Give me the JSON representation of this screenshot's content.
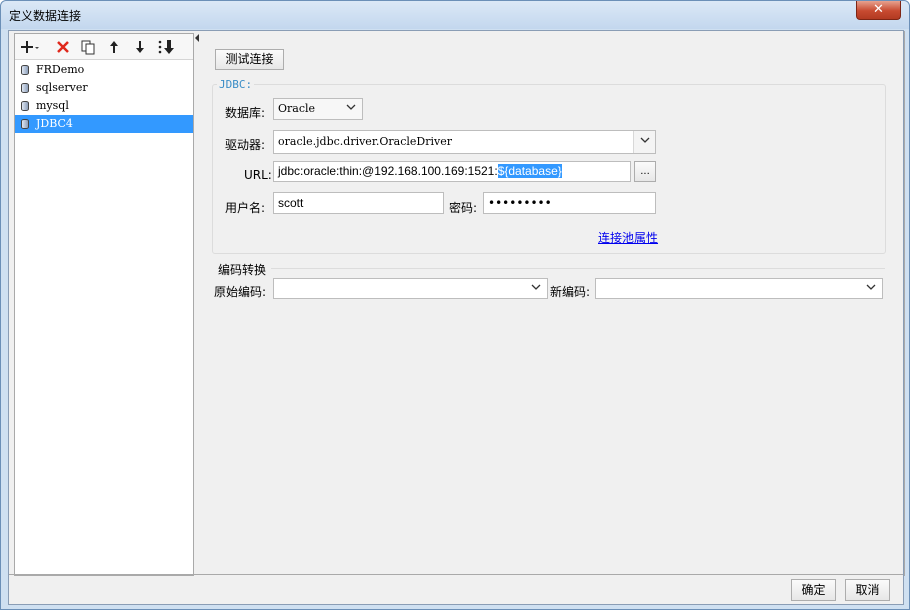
{
  "window": {
    "title": "定义数据连接",
    "close_label": "✕"
  },
  "toolbar": {
    "add_icon": "plus-icon",
    "delete_icon": "red-x-icon",
    "copy_icon": "copy-icon",
    "up_icon": "arrow-up-icon",
    "down_icon": "arrow-down-icon",
    "sort_icon": "sort-icon"
  },
  "connections": [
    {
      "label": "FRDemo",
      "selected": false
    },
    {
      "label": "sqlserver",
      "selected": false
    },
    {
      "label": "mysql",
      "selected": false
    },
    {
      "label": "JDBC4",
      "selected": true
    }
  ],
  "test_button": "测试连接",
  "jdbc": {
    "group_label": "JDBC:",
    "database_label": "数据库:",
    "database_value": "Oracle",
    "driver_label": "驱动器:",
    "driver_value": "oracle.jdbc.driver.OracleDriver",
    "url_label": "URL:",
    "url_prefix": "jdbc:oracle:thin:@192.168.100.169:1521:",
    "url_selected": "${database}",
    "url_more": "...",
    "username_label": "用户名:",
    "username_value": "scott",
    "password_label": "密码:",
    "password_value": "•••••••••",
    "pool_link": "连接池属性"
  },
  "encoding": {
    "section_title": "编码转换",
    "original_label": "原始编码:",
    "original_value": "",
    "new_label": "新编码:",
    "new_value": ""
  },
  "footer": {
    "ok": "确定",
    "cancel": "取消"
  },
  "colors": {
    "selection": "#3399ff",
    "link": "#0000ee",
    "close": "#c74a30"
  }
}
